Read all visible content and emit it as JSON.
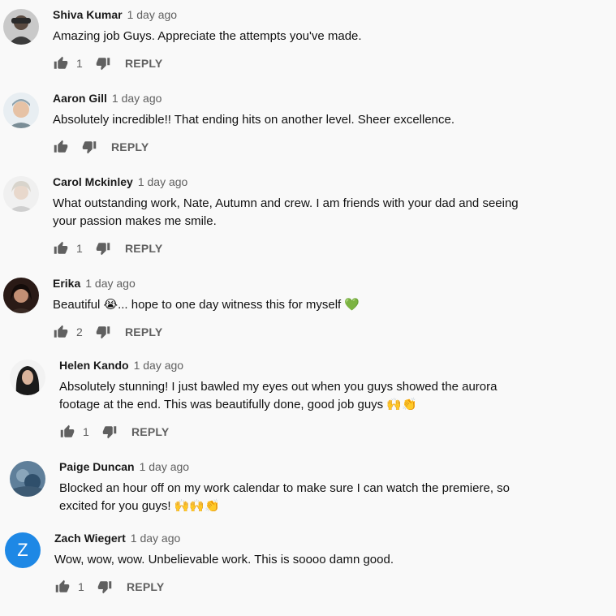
{
  "comments": [
    {
      "author": "Shiva Kumar",
      "time": "1 day ago",
      "text": "Amazing job Guys. Appreciate the attempts you've made.",
      "likes": "1",
      "reply": "REPLY"
    },
    {
      "author": "Aaron Gill",
      "time": "1 day ago",
      "text": "Absolutely incredible!! That ending hits on another level. Sheer excellence.",
      "likes": "",
      "reply": "REPLY"
    },
    {
      "author": "Carol Mckinley",
      "time": "1 day ago",
      "text": "What outstanding work, Nate, Autumn and crew. I am friends with your dad and seeing your passion makes me smile.",
      "likes": "1",
      "reply": "REPLY"
    },
    {
      "author": "Erika",
      "time": "1 day ago",
      "text": "Beautiful 😭... hope to one day witness this for myself 💚",
      "likes": "2",
      "reply": "REPLY"
    },
    {
      "author": "Helen Kando",
      "time": "1 day ago",
      "text": "Absolutely stunning! I just bawled my eyes out when you guys showed the aurora footage at the end. This was beautifully done, good job guys 🙌👏",
      "likes": "1",
      "reply": "REPLY"
    },
    {
      "author": "Paige Duncan",
      "time": "1 day ago",
      "text": "Blocked an hour off on my work calendar to make sure I can watch the premiere, so excited for you guys! 🙌🙌👏",
      "likes": "",
      "reply": "REPLY"
    },
    {
      "author": "Zach Wiegert",
      "time": "1 day ago",
      "text": "Wow, wow, wow. Unbelievable work. This is soooo damn good.",
      "likes": "1",
      "reply": "REPLY",
      "avatar_letter": "Z"
    }
  ],
  "colors": {
    "icon": "#606060",
    "letter_avatar": "#1e88e5",
    "background": "#f9f9f9"
  }
}
